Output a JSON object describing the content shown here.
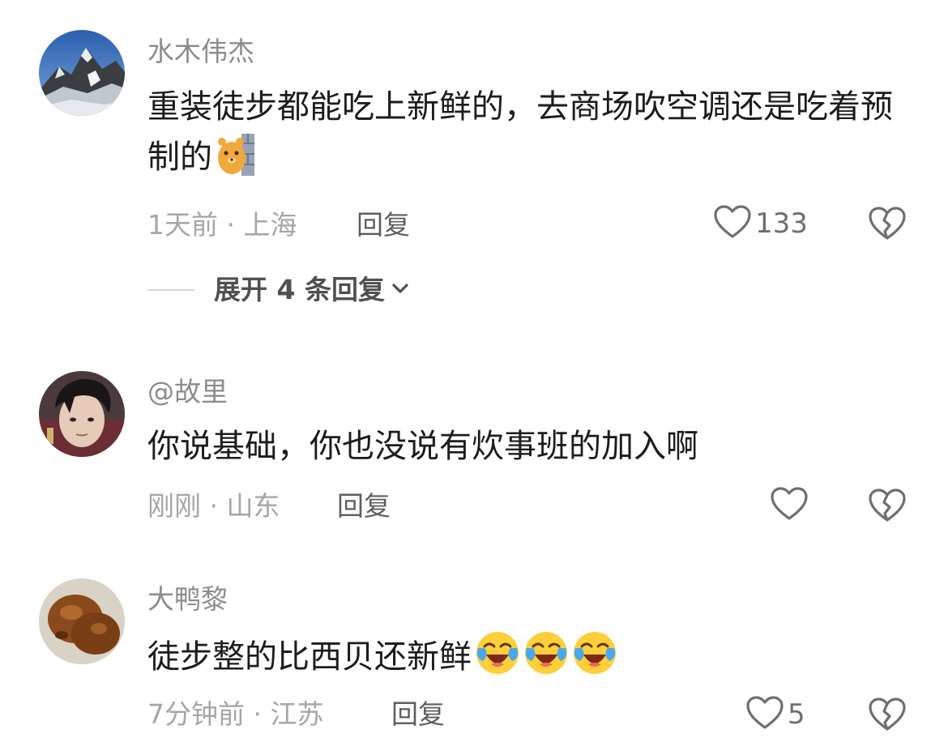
{
  "comments": [
    {
      "username": "水木伟杰",
      "text": "重装徒步都能吃上新鲜的，去商场吹空调还是吃着预制的",
      "emojis": [
        "bear-peek-emoji"
      ],
      "time": "1天前",
      "location": "上海",
      "meta": "1天前 · 上海",
      "reply_label": "回复",
      "likes": "133",
      "expand_label": "展开 4 条回复"
    },
    {
      "username": "@故里",
      "text": "你说基础，你也没说有炊事班的加入啊",
      "emojis": [],
      "time": "刚刚",
      "location": "山东",
      "meta": "刚刚 · 山东",
      "reply_label": "回复",
      "likes": ""
    },
    {
      "username": "大鸭黎",
      "text": "徒步整的比西贝还新鲜",
      "emojis": [
        "laugh-cry-emoji",
        "laugh-cry-emoji",
        "laugh-cry-emoji"
      ],
      "time": "7分钟前",
      "location": "江苏",
      "meta": "7分钟前 · 江苏",
      "reply_label": "回复",
      "likes": "5"
    }
  ],
  "icons": {
    "like": "heart-outline-icon",
    "dislike": "broken-heart-icon",
    "expand": "chevron-down-icon"
  },
  "colors": {
    "username": "#8c8c8c",
    "text": "#1c1c1c",
    "meta": "#a6a6a6",
    "reply": "#5e5e5e",
    "icon": "#6f6f6f"
  }
}
